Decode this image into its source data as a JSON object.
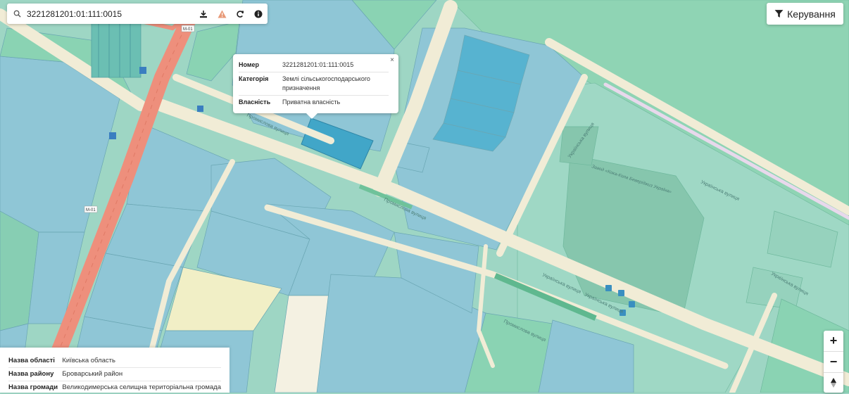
{
  "search": {
    "value": "3221281201:01:111:0015"
  },
  "toolbar": {
    "download_icon": "download-icon",
    "warning_icon": "warning-icon",
    "refresh_icon": "refresh-icon",
    "info_icon": "info-icon"
  },
  "controls": {
    "label": "Керування"
  },
  "popup": {
    "close": "×",
    "rows": [
      {
        "key": "Номер",
        "value": "3221281201:01:111:0015"
      },
      {
        "key": "Категорія",
        "value": "Землі сільськогосподарського призначення"
      },
      {
        "key": "Власність",
        "value": "Приватна власність"
      }
    ]
  },
  "info_panel": {
    "rows": [
      {
        "key": "Назва області",
        "value": "Київська область"
      },
      {
        "key": "Назва району",
        "value": "Броварський район"
      },
      {
        "key": "Назва громади",
        "value": "Великодимерська селищна територіальна громада"
      }
    ]
  },
  "zoom": {
    "in": "+",
    "out": "−"
  },
  "map": {
    "road_labels": [
      "M-01",
      "M-01",
      "Промислова вулиця",
      "Промислова вулиця",
      "Промислова вулиця",
      "Українська вулиця",
      "Українська вулиця",
      "Українська вулиця",
      "Українська вулиця",
      "Українська вулиця"
    ],
    "poi_label": "Завод «Кока-Кола Беверіджиз Україна»",
    "colors": {
      "background": "#9ed6c4",
      "parcel_blue": "#8fc6d6",
      "parcel_green": "#8ad3b3",
      "selected_parcel": "#41a6c8",
      "highway": "#ee8f7c",
      "road": "#f1ecd6"
    }
  }
}
